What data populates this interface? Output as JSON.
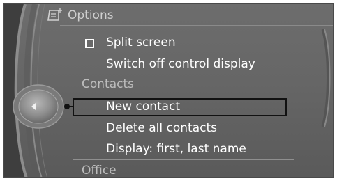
{
  "header": {
    "title": "Options",
    "icon": "options-list-icon"
  },
  "menu": {
    "split_screen": "Split screen",
    "switch_off": "Switch off control display",
    "section_contacts": "Contacts",
    "new_contact": "New contact",
    "delete_all": "Delete all contacts",
    "display_name": "Display: first, last name",
    "section_office": "Office"
  },
  "colors": {
    "background": "#666666",
    "text": "#ffffff",
    "section_text": "#bdbdbd",
    "highlight_border": "#111111"
  }
}
